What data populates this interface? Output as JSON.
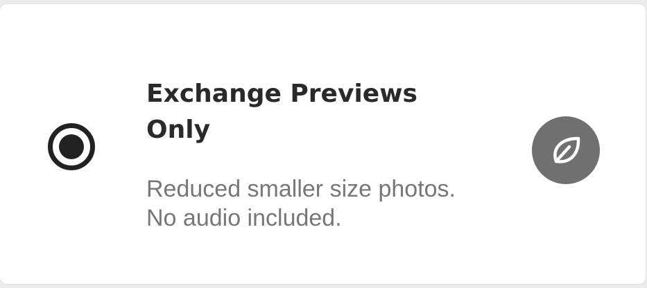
{
  "option": {
    "selected": true,
    "title": "Exchange Previews Only",
    "description": "Reduced smaller size photos. No audio included.",
    "radio_icon": "radio-selected-icon",
    "badge_icon": "leaf-icon",
    "colors": {
      "card_background": "#ffffff",
      "title_text": "#2a2a2a",
      "description_text": "#777777",
      "radio": "#222222",
      "badge_background": "#707070",
      "badge_icon": "#ffffff"
    }
  }
}
